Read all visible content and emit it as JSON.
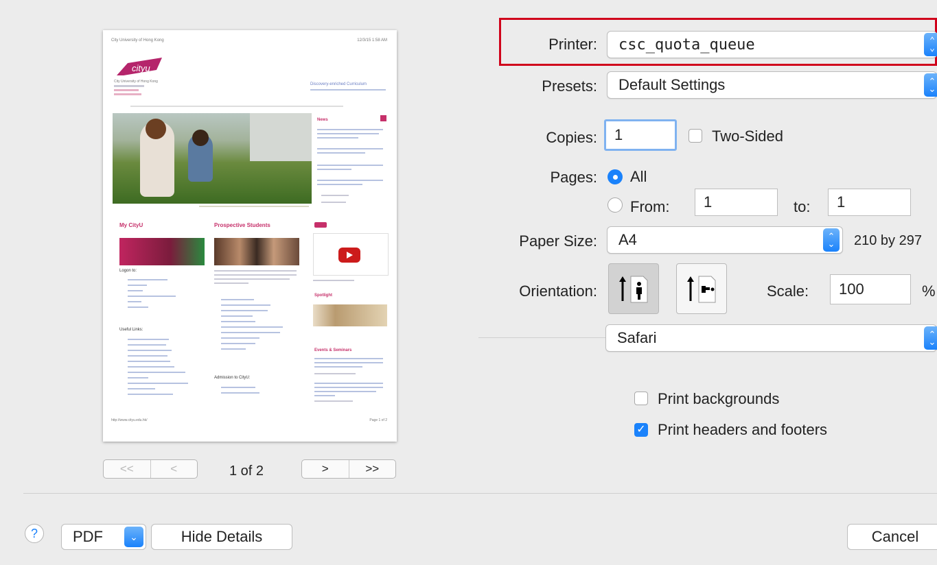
{
  "preview": {
    "site_org": "City University of Hong Kong",
    "site_tagline": "Discovery-enriched Curriculum",
    "section_my": "My CityU",
    "section_prospective": "Prospective Students",
    "login_to": "Logon to:",
    "useful_links": "Useful Links:",
    "admission": "Admission to CityU:",
    "news": "News",
    "spotlight": "Spotlight",
    "events": "Events & Seminars",
    "page_footer": "Page 1 of 2"
  },
  "nav": {
    "first": "<<",
    "prev": "<",
    "page_indicator": "1 of 2",
    "next": ">",
    "last": ">>"
  },
  "printer": {
    "label": "Printer:",
    "value": "csc_quota_queue",
    "highlight_color": "#d0021b"
  },
  "presets": {
    "label": "Presets:",
    "value": "Default Settings"
  },
  "copies": {
    "label": "Copies:",
    "value": "1",
    "two_sided_label": "Two-Sided",
    "two_sided_checked": false
  },
  "pages": {
    "label": "Pages:",
    "all_label": "All",
    "from_label": "From:",
    "from_value": "1",
    "to_label": "to:",
    "to_value": "1",
    "selected": "all"
  },
  "paper_size": {
    "label": "Paper Size:",
    "value": "A4",
    "dimensions": "210 by 297"
  },
  "orientation": {
    "label": "Orientation:",
    "selected": "portrait"
  },
  "scale": {
    "label": "Scale:",
    "value": "100",
    "unit": "%"
  },
  "app_section": {
    "value": "Safari"
  },
  "options": {
    "print_backgrounds": "Print backgrounds",
    "print_backgrounds_checked": false,
    "print_headers_footers": "Print headers and footers",
    "print_headers_footers_checked": true
  },
  "footer": {
    "help": "?",
    "pdf": "PDF",
    "hide_details": "Hide Details",
    "cancel": "Cancel"
  },
  "accent_color": "#1a82fb"
}
